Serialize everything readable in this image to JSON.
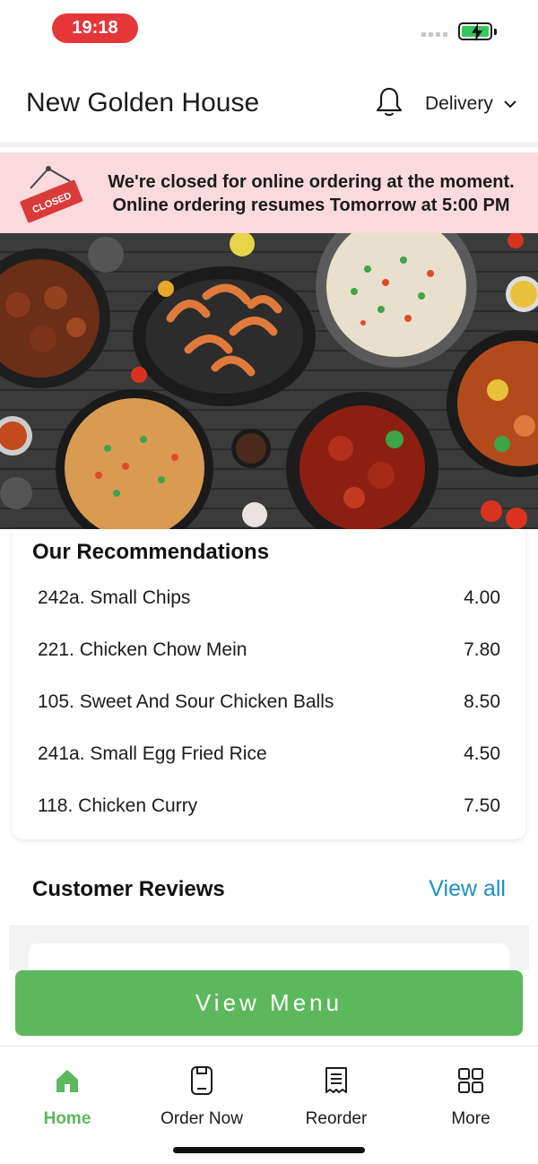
{
  "status_bar": {
    "time": "19:18"
  },
  "header": {
    "store_name": "New Golden House",
    "delivery_mode": "Delivery"
  },
  "closed_banner": {
    "sign_text": "CLOSED",
    "line1": "We're closed for online ordering at the moment.",
    "line2": "Online ordering resumes Tomorrow at 5:00 PM"
  },
  "recommendations": {
    "title": "Our Recommendations",
    "items": [
      {
        "name": "242a. Small Chips",
        "price": "4.00"
      },
      {
        "name": "221. Chicken Chow Mein",
        "price": "7.80"
      },
      {
        "name": "105. Sweet And Sour Chicken Balls",
        "price": "8.50"
      },
      {
        "name": "241a. Small Egg Fried Rice",
        "price": "4.50"
      },
      {
        "name": "118. Chicken Curry",
        "price": "7.50"
      }
    ]
  },
  "reviews": {
    "title": "Customer Reviews",
    "view_all": "View all"
  },
  "view_menu_label": "View Menu",
  "bottom_nav": {
    "items": [
      {
        "label": "Home",
        "icon": "home-icon",
        "active": true
      },
      {
        "label": "Order Now",
        "icon": "order-now-icon",
        "active": false
      },
      {
        "label": "Reorder",
        "icon": "receipt-icon",
        "active": false
      },
      {
        "label": "More",
        "icon": "grid-icon",
        "active": false
      }
    ]
  },
  "colors": {
    "accent_green": "#5cb85c",
    "link_blue": "#1d8fc4",
    "banner_pink": "#fadadd",
    "status_red": "#e5373a"
  }
}
